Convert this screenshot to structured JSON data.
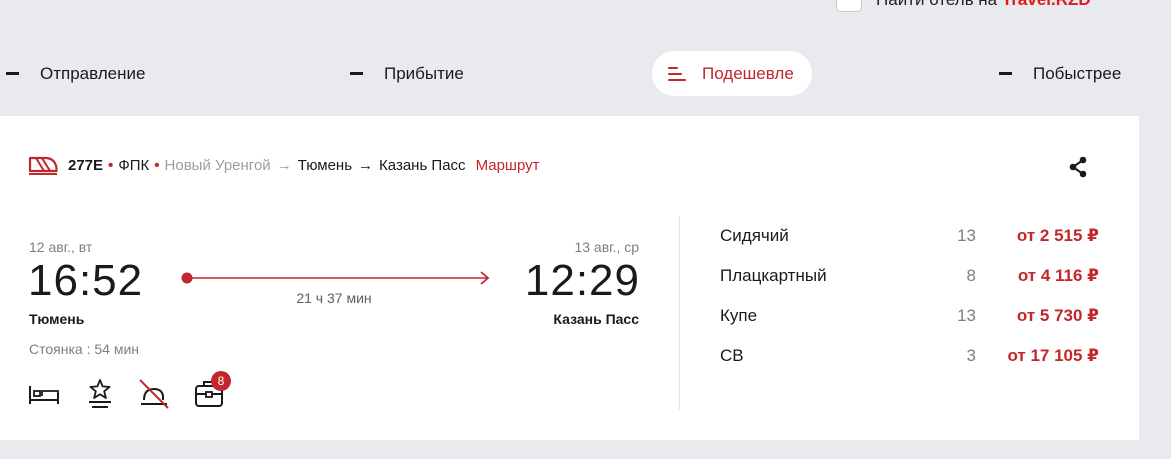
{
  "hotel": {
    "label": "Найти отель на ",
    "brand": "Travel.RZD"
  },
  "sort": {
    "departure": "Отправление",
    "arrival": "Прибытие",
    "cheaper": "Подешевле",
    "faster": "Побыстрее",
    "active": "cheaper"
  },
  "train": {
    "number": "277Е",
    "carrier": "ФПК",
    "route_from": "Новый Уренгой",
    "route_via": "Тюмень",
    "route_to": "Казань Пасс",
    "route_link": "Маршрут",
    "departure_date": "12 авг., вт",
    "departure_time": "16:52",
    "departure_station": "Тюмень",
    "arrival_date": "13 авг., ср",
    "arrival_time": "12:29",
    "arrival_station": "Казань Пасс",
    "duration": "21 ч 37 мин",
    "stop": "Стоянка : 54 мин",
    "amenity_icons": [
      "bed-icon",
      "star-service-icon",
      "no-sleep-icon",
      "baggage-icon"
    ],
    "baggage_badge": "8"
  },
  "fares": [
    {
      "class": "Сидячий",
      "count": "13",
      "price": "от 2 515 ₽"
    },
    {
      "class": "Плацкартный",
      "count": "8",
      "price": "от 4 116 ₽"
    },
    {
      "class": "Купе",
      "count": "13",
      "price": "от 5 730 ₽"
    },
    {
      "class": "СВ",
      "count": "3",
      "price": "от 17 105 ₽"
    }
  ],
  "colors": {
    "accent": "#c1272d",
    "background": "#e9eaee",
    "card": "#ffffff"
  }
}
